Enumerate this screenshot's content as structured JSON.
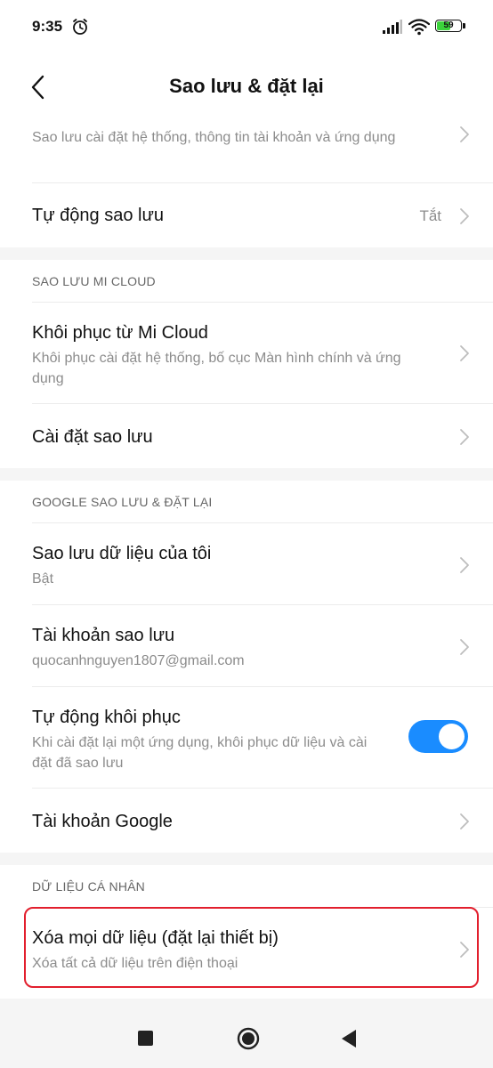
{
  "status_bar": {
    "time": "9:35",
    "battery_level": "59",
    "battery_percent": 59,
    "icons": [
      "alarm-icon",
      "signal-icon",
      "wifi-icon",
      "battery-icon"
    ]
  },
  "header": {
    "title": "Sao lưu & đặt lại",
    "back_icon": "chevron-left-icon"
  },
  "top_group": {
    "partial_item": {
      "subtitle": "Sao lưu cài đặt hệ thống, thông tin tài khoản và ứng dụng"
    },
    "auto_backup": {
      "title": "Tự động sao lưu",
      "value": "Tắt"
    }
  },
  "mi_cloud": {
    "header": "SAO LƯU MI CLOUD",
    "restore": {
      "title": "Khôi phục từ Mi Cloud",
      "subtitle": "Khôi phục cài đặt hệ thống, bố cục Màn hình chính và ứng dụng"
    },
    "backup_settings": {
      "title": "Cài đặt sao lưu"
    }
  },
  "google": {
    "header": "GOOGLE SAO LƯU & ĐẶT LẠI",
    "backup_data": {
      "title": "Sao lưu dữ liệu của tôi",
      "subtitle": "Bật"
    },
    "backup_account": {
      "title": "Tài khoản sao lưu",
      "subtitle": "quocanhnguyen1807@gmail.com"
    },
    "auto_restore": {
      "title": "Tự động khôi phục",
      "subtitle": "Khi cài đặt lại một ứng dụng, khôi phục dữ liệu và cài đặt đã sao lưu",
      "enabled": true
    },
    "google_account": {
      "title": "Tài khoản Google"
    }
  },
  "personal": {
    "header": "DỮ LIỆU CÁ NHÂN",
    "factory_reset": {
      "title": "Xóa mọi dữ liệu (đặt lại thiết bị)",
      "subtitle": "Xóa tất cả dữ liệu trên điện thoại"
    }
  },
  "colors": {
    "accent": "#1a8cff",
    "highlight": "#e21f2d",
    "background": "#f5f5f5",
    "card": "#ffffff",
    "secondary_text": "#8c8c8c"
  },
  "nav_bar": {
    "icons": [
      "recent-apps-icon",
      "home-icon",
      "back-triangle-icon"
    ]
  }
}
